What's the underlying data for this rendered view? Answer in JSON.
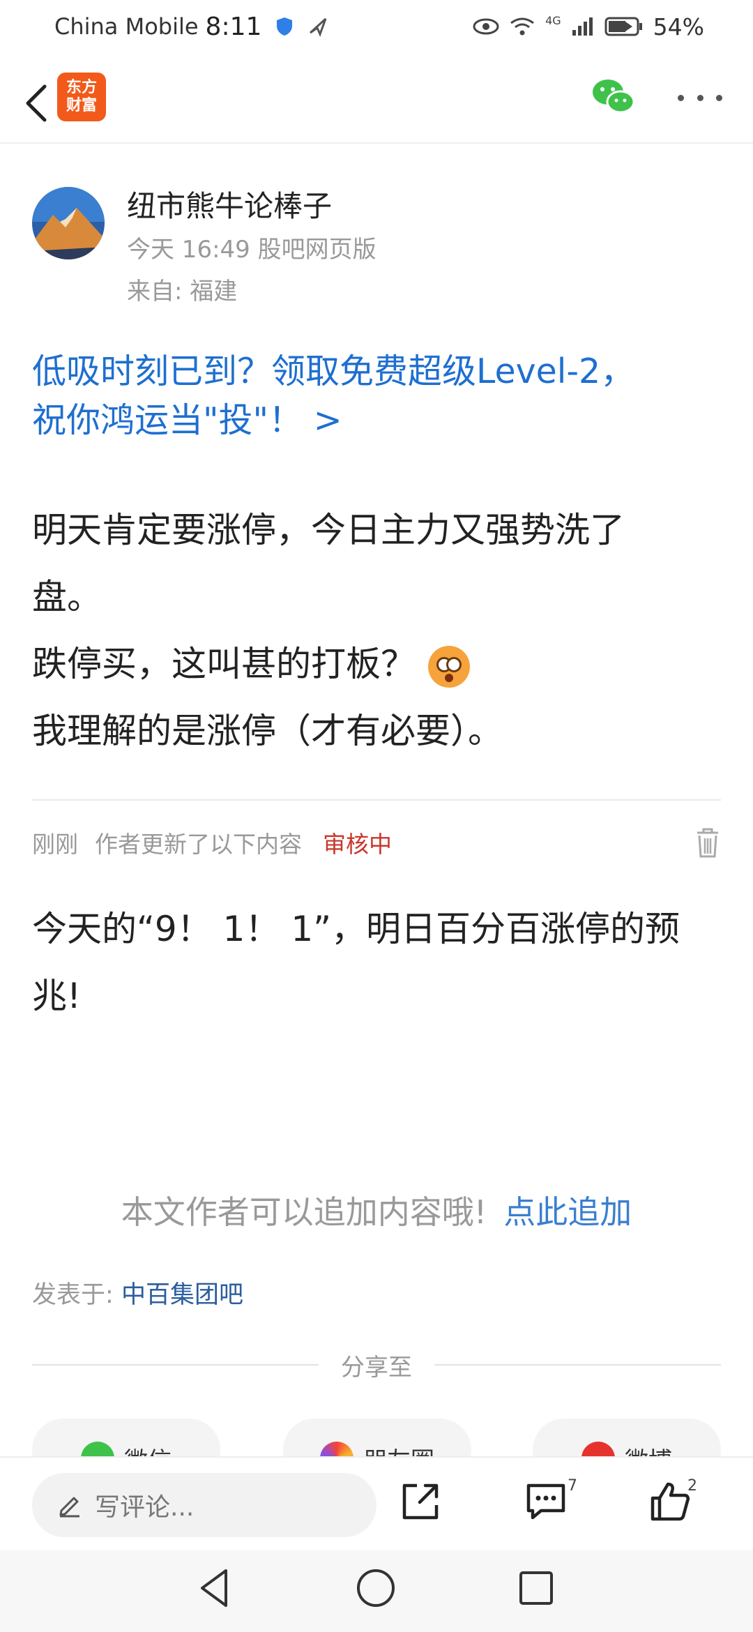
{
  "status_bar": {
    "carrier": "China Mobile",
    "time": "8:11",
    "network": "4G",
    "battery": "54%"
  },
  "header": {
    "logo_line1": "东方",
    "logo_line2": "财富"
  },
  "post": {
    "author": "纽市熊牛论棒子",
    "meta": "今天 16:49 股吧网页版",
    "location": "来自: 福建",
    "promo_line1": "低吸时刻已到？领取免费超级Level-2，",
    "promo_line2": "祝你鸿运当\"投\"！ >",
    "body_lines": [
      "明天肯定要涨停，今日主力又强势洗了",
      "盘。",
      "跌停买，这叫甚的打板？",
      "我理解的是涨停（才有必要）。"
    ]
  },
  "update": {
    "time": "刚刚",
    "label": "作者更新了以下内容",
    "status": "审核中",
    "lines": [
      "今天的“9！ 1！ 1”，明日百分百涨停的预",
      "兆!"
    ]
  },
  "append": {
    "text": "本文作者可以追加内容哦!",
    "link": "点此追加"
  },
  "posted_in": {
    "label": "发表于:",
    "bar": "中百集团吧"
  },
  "share": {
    "title": "分享至",
    "targets": [
      "微信",
      "朋友圈",
      "微博"
    ]
  },
  "action_bar": {
    "comment_placeholder": "写评论...",
    "comment_count": "7",
    "like_count": "2"
  }
}
